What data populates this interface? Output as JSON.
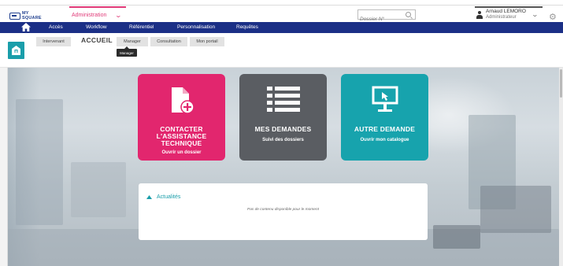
{
  "app": {
    "logo_line1": "MY",
    "logo_line2": "SQUARE",
    "module": "Administration"
  },
  "search": {
    "placeholder": "Dossier N°"
  },
  "user": {
    "name": "Arnaud LEMORO",
    "role": "Administrateur"
  },
  "nav": {
    "items": [
      "Accès",
      "Workflow",
      "Référentiel",
      "Personnalisation",
      "Requêtes"
    ]
  },
  "subtabs": {
    "intervenant": "Intervenant",
    "active": "ACCUEIL",
    "manager": "Manager",
    "consultation": "Consultation",
    "mon_portail": "Mon portail",
    "tooltip": "Manager"
  },
  "cards": [
    {
      "title": "CONTACTER L'ASSISTANCE TECHNIQUE",
      "subtitle": "Ouvrir un dossier",
      "color": "#e2266e",
      "icon": "document-plus-icon"
    },
    {
      "title": "MES DEMANDES",
      "subtitle": "Suivi des dossiers",
      "color": "#5a5d62",
      "icon": "list-icon"
    },
    {
      "title": "AUTRE DEMANDE",
      "subtitle": "Ouvrir mon catalogue",
      "color": "#17a3ad",
      "icon": "kiosk-icon"
    }
  ],
  "news": {
    "title": "Actualités",
    "empty": "Pas de contenu disponible pour le moment"
  },
  "colors": {
    "nav_bg": "#1b2f86",
    "accent_pink": "#e03a78",
    "teal": "#1a9eaa"
  }
}
